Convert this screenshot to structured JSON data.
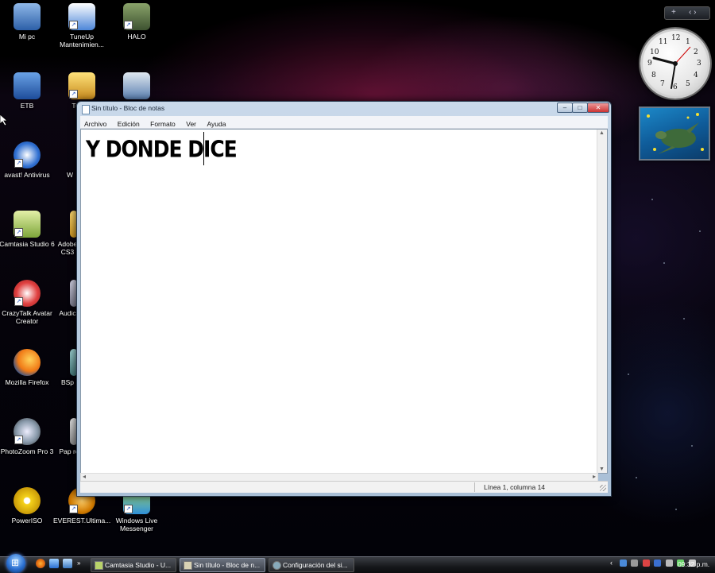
{
  "desktop": {
    "icons": [
      {
        "label": "Mi pc"
      },
      {
        "label": "TuneUp Mantenimien..."
      },
      {
        "label": "HALO"
      },
      {
        "label": "ETB"
      },
      {
        "label": "TuneU"
      },
      {
        "label": ""
      },
      {
        "label": "avast! Antivirus"
      },
      {
        "label": "W"
      },
      {
        "label": "Camtasia Studio 6"
      },
      {
        "label": "Adobe CS3"
      },
      {
        "label": "CrazyTalk Avatar Creator"
      },
      {
        "label": "Audic"
      },
      {
        "label": "Mozilla Firefox"
      },
      {
        "label": "BSp"
      },
      {
        "label": "PhotoZoom Pro 3"
      },
      {
        "label": "Pap re"
      },
      {
        "label": "PowerISO"
      },
      {
        "label": "EVEREST.Ultima..."
      },
      {
        "label": "Windows Live Messenger"
      }
    ]
  },
  "gadgets": {
    "add_symbol": "+",
    "nav_symbols": "‹ ›",
    "clock_numbers": [
      "12",
      "1",
      "2",
      "3",
      "4",
      "5",
      "6",
      "7",
      "8",
      "9",
      "10",
      "11"
    ]
  },
  "notepad": {
    "title": "Sin título - Bloc de notas",
    "menu": [
      "Archivo",
      "Edición",
      "Formato",
      "Ver",
      "Ayuda"
    ],
    "content": "Y DONDE DICE",
    "status": "Línea 1, columna 14",
    "controls": {
      "minimize": "–",
      "maximize": "□",
      "close": "✕"
    }
  },
  "taskbar": {
    "start_symbol": "⊞",
    "buttons": [
      {
        "label": "Camtasia Studio - U...",
        "active": false
      },
      {
        "label": "Sin título - Bloc de n...",
        "active": true
      },
      {
        "label": "Configuración del si...",
        "active": false
      }
    ],
    "tray_chevron": "‹",
    "clock": "09:32 p.m."
  },
  "colors": {
    "window_frame": "#c9d9ea",
    "taskbar": "#16181b",
    "accent": "#2a6fd0"
  }
}
